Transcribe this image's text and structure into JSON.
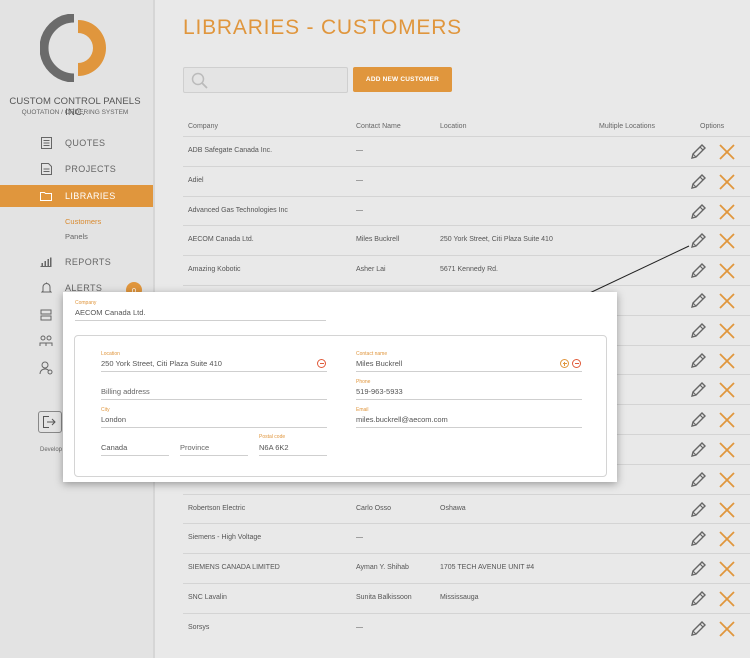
{
  "brand": {
    "name": "CUSTOM CONTROL PANELS INC.",
    "tagline": "QUOTATION / ORDERING SYSTEM",
    "colors": {
      "accent": "#e0963d",
      "logo_gray": "#6b6b6b"
    }
  },
  "sidebar": {
    "items": [
      {
        "label": "QUOTES",
        "icon": "quotes-icon"
      },
      {
        "label": "PROJECTS",
        "icon": "projects-icon"
      },
      {
        "label": "LIBRARIES",
        "icon": "folder-icon",
        "active": true
      },
      {
        "label": "REPORTS",
        "icon": "reports-icon"
      },
      {
        "label": "ALERTS",
        "icon": "bell-icon",
        "badge": "0"
      }
    ],
    "sub_items": [
      {
        "label": "Customers",
        "active": true
      },
      {
        "label": "Panels"
      }
    ],
    "footer_text": "Develop"
  },
  "main": {
    "title": "LIBRARIES - CUSTOMERS",
    "search_placeholder": "",
    "add_button": "ADD NEW CUSTOMER",
    "columns": [
      "Company",
      "Contact Name",
      "Location",
      "Multiple Locations",
      "Options"
    ],
    "rows": [
      {
        "company": "ADB Safegate Canada Inc.",
        "contact": "—",
        "location": ""
      },
      {
        "company": "Adiel",
        "contact": "—",
        "location": ""
      },
      {
        "company": "Advanced Gas Technologies Inc",
        "contact": "—",
        "location": ""
      },
      {
        "company": "AECOM Canada Ltd.",
        "contact": "Miles Buckrell",
        "location": "250 York Street, Citi Plaza Suite 410"
      },
      {
        "company": "Amazing Kobotic",
        "contact": "Asher Lai",
        "location": "5671 Kennedy Rd."
      },
      {
        "company": "",
        "contact": "",
        "location": ""
      },
      {
        "company": "",
        "contact": "",
        "location": ""
      },
      {
        "company": "",
        "contact": "",
        "location": ""
      },
      {
        "company": "",
        "contact": "",
        "location": ""
      },
      {
        "company": "",
        "contact": "",
        "location": ""
      },
      {
        "company": "",
        "contact": "",
        "location": ""
      },
      {
        "company": "",
        "contact": "",
        "location": ""
      },
      {
        "company": "Robertson Electric",
        "contact": "Carlo Osso",
        "location": "Oshawa"
      },
      {
        "company": "Siemens - High Voltage",
        "contact": "—",
        "location": ""
      },
      {
        "company": "SIEMENS CANADA LIMITED",
        "contact": "Ayman Y. Shihab",
        "location": "1705 TECH AVENUE UNIT #4"
      },
      {
        "company": "SNC Lavalin",
        "contact": "Sunita Balkissoon",
        "location": "Mississauga"
      },
      {
        "company": "Sorsys",
        "contact": "—",
        "location": ""
      }
    ]
  },
  "popup": {
    "company_label": "Company",
    "company_value": "AECOM Canada Ltd.",
    "location_label": "Location",
    "location_value": "250 York Street, Citi Plaza Suite 410",
    "billing_placeholder": "Billing address",
    "city_label": "City",
    "city_value": "London",
    "country_value": "Canada",
    "province_placeholder": "Province",
    "postal_label": "Postal code",
    "postal_value": "N6A 6K2",
    "contact_label": "Contact name",
    "contact_value": "Miles Buckrell",
    "phone_label": "Phone",
    "phone_value": "519-963-5933",
    "email_label": "Email",
    "email_value": "miles.buckrell@aecom.com"
  }
}
